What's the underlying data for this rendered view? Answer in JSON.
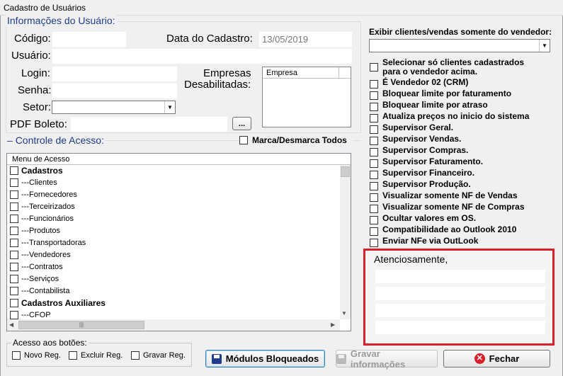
{
  "window": {
    "title": "Cadastro de Usuários"
  },
  "user_info": {
    "heading": "Informações do Usuário:",
    "codigo_label": "Código:",
    "codigo_value": "",
    "data_cadastro_label": "Data do Cadastro:",
    "data_cadastro_value": "13/05/2019",
    "usuario_label": "Usuário:",
    "usuario_value": "",
    "login_label": "Login:",
    "login_value": "",
    "senha_label": "Senha:",
    "senha_value": "",
    "setor_label": "Setor:",
    "setor_value": "",
    "pdf_boleto_label": "PDF Boleto:",
    "pdf_boleto_value": "",
    "browse_label": "...",
    "empresas_label_1": "Empresas",
    "empresas_label_2": "Desabilitadas:",
    "empresas_column": "Empresa"
  },
  "access": {
    "heading": "Controle de Acesso:",
    "marca_desmarca_label": "Marca/Desmarca Todos",
    "column_header": "Menu de Acesso",
    "items": [
      {
        "label": "Cadastros",
        "bold": true
      },
      {
        "label": "---Clientes",
        "bold": false
      },
      {
        "label": "---Fornecedores",
        "bold": false
      },
      {
        "label": "---Terceirizados",
        "bold": false
      },
      {
        "label": "---Funcionários",
        "bold": false
      },
      {
        "label": "---Produtos",
        "bold": false
      },
      {
        "label": "---Transportadoras",
        "bold": false
      },
      {
        "label": "---Vendedores",
        "bold": false
      },
      {
        "label": "---Contratos",
        "bold": false
      },
      {
        "label": "---Serviços",
        "bold": false
      },
      {
        "label": "---Contabilista",
        "bold": false
      },
      {
        "label": "Cadastros Auxiliares",
        "bold": true
      },
      {
        "label": "---CFOP",
        "bold": false
      }
    ],
    "buttons_group_label": "Acesso aos botões:",
    "novo_reg": "Novo Reg.",
    "excluir_reg": "Excluir Reg.",
    "gravar_reg": "Gravar Reg."
  },
  "right_panel": {
    "vendor_filter_label": "Exibir clientes/vendas somente do vendedor:",
    "vendor_filter_value": "",
    "options": [
      {
        "label": "Selecionar só clientes cadastrados",
        "label2": "para o vendedor acima."
      },
      {
        "label": "É Vendedor 02 (CRM)"
      },
      {
        "label": "Bloquear limite por faturamento"
      },
      {
        "label": "Bloquear limite por atraso"
      },
      {
        "label": "Atualiza preços no inicio do sistema"
      },
      {
        "label": "Supervisor Geral."
      },
      {
        "label": "Supervisor Vendas."
      },
      {
        "label": "Supervisor Compras."
      },
      {
        "label": "Supervisor Faturamento."
      },
      {
        "label": "Supervisor Financeiro."
      },
      {
        "label": "Supervisor Produção."
      },
      {
        "label": "Visualizar somente NF de Vendas"
      },
      {
        "label": "Visualizar somente NF de Compras"
      },
      {
        "label": "Ocultar valores em OS."
      },
      {
        "label": "Compatibilidade ao Outlook 2010"
      },
      {
        "label": "Enviar NFe via OutLook"
      }
    ],
    "signature_label": "Atenciosamente,"
  },
  "footer": {
    "modulos_label": "Módulos Bloqueados",
    "gravar_label": "Gravar informações",
    "fechar_label": "Fechar"
  },
  "colors": {
    "heading_blue": "#1f3d8c",
    "highlight_red": "#d9202a"
  }
}
